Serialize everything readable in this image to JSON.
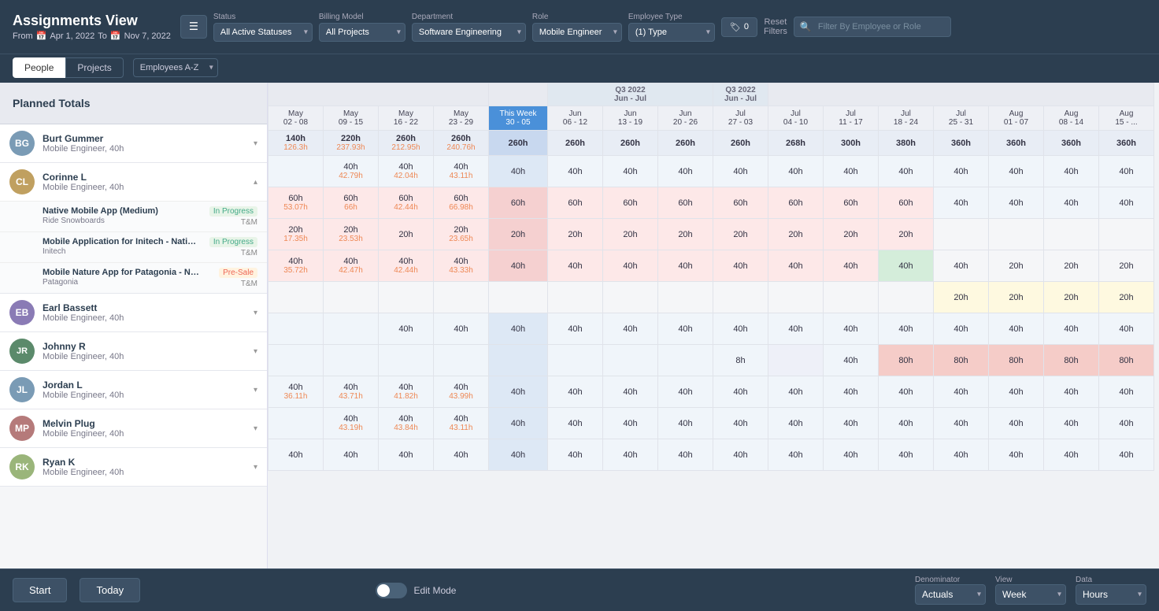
{
  "header": {
    "title": "Assignments View",
    "date_from_label": "From",
    "date_to_label": "To",
    "date_from": "Apr 1, 2022",
    "date_to": "Nov 7, 2022"
  },
  "filters": {
    "filter_icon_label": "☰",
    "status_label": "Status",
    "status_value": "All Active Statuses",
    "billing_label": "Billing Model",
    "billing_value": "All Projects",
    "dept_label": "Department",
    "dept_value": "Software Engineering",
    "role_label": "Role",
    "role_value": "Mobile Engineer",
    "emp_type_label": "Employee Type",
    "emp_type_value": "(1) Type",
    "tag_label": "0",
    "reset_label": "Reset\nFilters",
    "search_placeholder": "Filter By Employee or Role"
  },
  "toolbar": {
    "tab_people": "People",
    "tab_projects": "Projects",
    "sort_label": "Employees A-Z"
  },
  "planned_totals": "Planned Totals",
  "columns": [
    {
      "id": "may0208",
      "quarter": "",
      "label": "May\n02 - 08"
    },
    {
      "id": "may0915",
      "quarter": "",
      "label": "May\n09 - 15"
    },
    {
      "id": "may1622",
      "quarter": "",
      "label": "May\n16 - 22"
    },
    {
      "id": "may2329",
      "quarter": "",
      "label": "May\n23 - 29"
    },
    {
      "id": "thisweek",
      "quarter": "",
      "label": "This Week\n30 - 05",
      "current": true
    },
    {
      "id": "jun0612",
      "quarter": "Q3 2022\nJun - Jul",
      "label": "Jun\n06 - 12"
    },
    {
      "id": "jun1319",
      "quarter": "",
      "label": "Jun\n13 - 19"
    },
    {
      "id": "jun2026",
      "quarter": "",
      "label": "Jun\n20 - 26"
    },
    {
      "id": "jul2703",
      "quarter": "Q3 2022\nJun - Jul",
      "label": "Jul\n27 - 03"
    },
    {
      "id": "jul0410",
      "quarter": "",
      "label": "Jul\n04 - 10"
    },
    {
      "id": "jul1117",
      "quarter": "",
      "label": "Jul\n11 - 17"
    },
    {
      "id": "jul1824",
      "quarter": "",
      "label": "Jul\n18 - 24"
    },
    {
      "id": "jul2531",
      "quarter": "",
      "label": "Jul\n25 - 31"
    },
    {
      "id": "aug0107",
      "quarter": "",
      "label": "Aug\n01 - 07"
    },
    {
      "id": "aug0814",
      "quarter": "",
      "label": "Aug\n08 - 14"
    },
    {
      "id": "aug15",
      "quarter": "",
      "label": "Aug\n15 - ..."
    }
  ],
  "totals_row": {
    "values": {
      "may0208": {
        "main": "140h",
        "sub": "126.3h"
      },
      "may0915": {
        "main": "220h",
        "sub": "237.93h"
      },
      "may1622": {
        "main": "260h",
        "sub": "212.95h"
      },
      "may2329": {
        "main": "260h",
        "sub": "240.76h"
      },
      "thisweek": {
        "main": "260h",
        "sub": ""
      },
      "jun0612": {
        "main": "260h",
        "sub": ""
      },
      "jun1319": {
        "main": "260h",
        "sub": ""
      },
      "jun2026": {
        "main": "260h",
        "sub": ""
      },
      "jul2703": {
        "main": "260h",
        "sub": ""
      },
      "jul0410": {
        "main": "268h",
        "sub": ""
      },
      "jul1117": {
        "main": "300h",
        "sub": ""
      },
      "jul1824": {
        "main": "380h",
        "sub": ""
      },
      "jul2531": {
        "main": "360h",
        "sub": ""
      },
      "aug0107": {
        "main": "360h",
        "sub": ""
      },
      "aug0814": {
        "main": "360h",
        "sub": ""
      },
      "aug15": {
        "main": "360h",
        "sub": ""
      }
    }
  },
  "employees": [
    {
      "id": "burt",
      "name": "Burt Gummer",
      "role": "Mobile Engineer, 40h",
      "avatar_initials": "BG",
      "avatar_color": "#7a9bb5",
      "expanded": false,
      "values": {
        "may0208": {
          "main": "",
          "sub": ""
        },
        "may0915": {
          "main": "40h",
          "sub": "42.79h"
        },
        "may1622": {
          "main": "40h",
          "sub": "42.04h"
        },
        "may2329": {
          "main": "40h",
          "sub": "43.11h"
        },
        "thisweek": {
          "main": "40h",
          "sub": ""
        },
        "jun0612": {
          "main": "40h",
          "sub": ""
        },
        "jun1319": {
          "main": "40h",
          "sub": ""
        },
        "jun2026": {
          "main": "40h",
          "sub": ""
        },
        "jul2703": {
          "main": "40h",
          "sub": ""
        },
        "jul0410": {
          "main": "40h",
          "sub": ""
        },
        "jul1117": {
          "main": "40h",
          "sub": ""
        },
        "jul1824": {
          "main": "40h",
          "sub": ""
        },
        "jul2531": {
          "main": "40h",
          "sub": ""
        },
        "aug0107": {
          "main": "40h",
          "sub": ""
        },
        "aug0814": {
          "main": "40h",
          "sub": ""
        },
        "aug15": {
          "main": "40h",
          "sub": ""
        }
      }
    },
    {
      "id": "corinne",
      "name": "Corinne L",
      "role": "Mobile Engineer, 40h",
      "avatar_initials": "CL",
      "avatar_color": "#c0a060",
      "expanded": true,
      "values": {
        "may0208": {
          "main": "60h",
          "sub": "53.07h"
        },
        "may0915": {
          "main": "60h",
          "sub": "66h"
        },
        "may1622": {
          "main": "60h",
          "sub": "42.44h"
        },
        "may2329": {
          "main": "60h",
          "sub": "66.98h"
        },
        "thisweek": {
          "main": "60h",
          "sub": ""
        },
        "jun0612": {
          "main": "60h",
          "sub": ""
        },
        "jun1319": {
          "main": "60h",
          "sub": ""
        },
        "jun2026": {
          "main": "60h",
          "sub": ""
        },
        "jul2703": {
          "main": "60h",
          "sub": ""
        },
        "jul0410": {
          "main": "60h",
          "sub": ""
        },
        "jul1117": {
          "main": "60h",
          "sub": ""
        },
        "jul1824": {
          "main": "60h",
          "sub": ""
        },
        "jul2531": {
          "main": "40h",
          "sub": ""
        },
        "aug0107": {
          "main": "40h",
          "sub": ""
        },
        "aug0814": {
          "main": "40h",
          "sub": ""
        },
        "aug15": {
          "main": "40h",
          "sub": ""
        }
      },
      "projects": [
        {
          "id": "native-mobile",
          "name": "Native Mobile App (Medium)",
          "client": "Ride Snowboards",
          "status": "In Progress",
          "billing": "T&M",
          "color": "red",
          "values": {
            "may0208": {
              "main": "20h",
              "sub": "17.35h"
            },
            "may0915": {
              "main": "20h",
              "sub": "23.53h"
            },
            "may1622": {
              "main": "20h",
              "sub": ""
            },
            "may2329": {
              "main": "20h",
              "sub": "23.65h"
            },
            "thisweek": {
              "main": "20h",
              "sub": ""
            },
            "jun0612": {
              "main": "20h",
              "sub": ""
            },
            "jun1319": {
              "main": "20h",
              "sub": ""
            },
            "jun2026": {
              "main": "20h",
              "sub": ""
            },
            "jul2703": {
              "main": "20h",
              "sub": ""
            },
            "jul0410": {
              "main": "20h",
              "sub": ""
            },
            "jul1117": {
              "main": "20h",
              "sub": ""
            },
            "jul1824": {
              "main": "20h",
              "sub": ""
            },
            "jul2531": {
              "main": "",
              "sub": ""
            },
            "aug0107": {
              "main": "",
              "sub": ""
            },
            "aug0814": {
              "main": "",
              "sub": ""
            },
            "aug15": {
              "main": "",
              "sub": ""
            }
          }
        },
        {
          "id": "mobile-initech",
          "name": "Mobile Application for Initech - Native M...",
          "client": "Initech",
          "status": "In Progress",
          "billing": "T&M",
          "color": "red",
          "values": {
            "may0208": {
              "main": "40h",
              "sub": "35.72h"
            },
            "may0915": {
              "main": "40h",
              "sub": "42.47h"
            },
            "may1622": {
              "main": "40h",
              "sub": "42.44h"
            },
            "may2329": {
              "main": "40h",
              "sub": "43.33h"
            },
            "thisweek": {
              "main": "40h",
              "sub": ""
            },
            "jun0612": {
              "main": "40h",
              "sub": ""
            },
            "jun1319": {
              "main": "40h",
              "sub": ""
            },
            "jun2026": {
              "main": "40h",
              "sub": ""
            },
            "jul2703": {
              "main": "40h",
              "sub": ""
            },
            "jul0410": {
              "main": "40h",
              "sub": ""
            },
            "jul1117": {
              "main": "40h",
              "sub": ""
            },
            "jul1824": {
              "main": "40h",
              "sub": ""
            },
            "jul2531": {
              "main": "40h",
              "sub": ""
            },
            "aug0107": {
              "main": "20h",
              "sub": ""
            },
            "aug0814": {
              "main": "20h",
              "sub": ""
            },
            "aug15": {
              "main": "20h",
              "sub": ""
            }
          }
        },
        {
          "id": "mobile-patagonia",
          "name": "Mobile Nature App for Patagonia - Native...",
          "client": "Patagonia",
          "status": "Pre-Sale",
          "billing": "T&M",
          "color": "yellow",
          "values": {
            "may0208": {
              "main": "",
              "sub": ""
            },
            "may0915": {
              "main": "",
              "sub": ""
            },
            "may1622": {
              "main": "",
              "sub": ""
            },
            "may2329": {
              "main": "",
              "sub": ""
            },
            "thisweek": {
              "main": "",
              "sub": ""
            },
            "jun0612": {
              "main": "",
              "sub": ""
            },
            "jun1319": {
              "main": "",
              "sub": ""
            },
            "jun2026": {
              "main": "",
              "sub": ""
            },
            "jul2703": {
              "main": "",
              "sub": ""
            },
            "jul0410": {
              "main": "",
              "sub": ""
            },
            "jul1117": {
              "main": "",
              "sub": ""
            },
            "jul1824": {
              "main": "",
              "sub": ""
            },
            "jul2531": {
              "main": "20h",
              "sub": ""
            },
            "aug0107": {
              "main": "20h",
              "sub": ""
            },
            "aug0814": {
              "main": "20h",
              "sub": ""
            },
            "aug15": {
              "main": "20h",
              "sub": ""
            }
          }
        }
      ]
    },
    {
      "id": "earl",
      "name": "Earl Bassett",
      "role": "Mobile Engineer, 40h",
      "avatar_initials": "EB",
      "avatar_color": "#8a7bb5",
      "expanded": false,
      "values": {
        "may0208": {
          "main": "",
          "sub": ""
        },
        "may0915": {
          "main": "",
          "sub": ""
        },
        "may1622": {
          "main": "40h",
          "sub": ""
        },
        "may2329": {
          "main": "40h",
          "sub": ""
        },
        "thisweek": {
          "main": "40h",
          "sub": ""
        },
        "jun0612": {
          "main": "40h",
          "sub": ""
        },
        "jun1319": {
          "main": "40h",
          "sub": ""
        },
        "jun2026": {
          "main": "40h",
          "sub": ""
        },
        "jul2703": {
          "main": "40h",
          "sub": ""
        },
        "jul0410": {
          "main": "40h",
          "sub": ""
        },
        "jul1117": {
          "main": "40h",
          "sub": ""
        },
        "jul1824": {
          "main": "40h",
          "sub": ""
        },
        "jul2531": {
          "main": "40h",
          "sub": ""
        },
        "aug0107": {
          "main": "40h",
          "sub": ""
        },
        "aug0814": {
          "main": "40h",
          "sub": ""
        },
        "aug15": {
          "main": "40h",
          "sub": ""
        }
      }
    },
    {
      "id": "johnny",
      "name": "Johnny R",
      "role": "Mobile Engineer, 40h",
      "avatar_initials": "JR",
      "avatar_color": "#5b8a6b",
      "expanded": false,
      "values": {
        "may0208": {
          "main": "",
          "sub": ""
        },
        "may0915": {
          "main": "",
          "sub": ""
        },
        "may1622": {
          "main": "",
          "sub": ""
        },
        "may2329": {
          "main": "",
          "sub": ""
        },
        "thisweek": {
          "main": "",
          "sub": ""
        },
        "jun0612": {
          "main": "",
          "sub": ""
        },
        "jun1319": {
          "main": "",
          "sub": ""
        },
        "jun2026": {
          "main": "",
          "sub": ""
        },
        "jul2703": {
          "main": "8h",
          "sub": ""
        },
        "jul0410": {
          "main": "",
          "sub": ""
        },
        "jul1117": {
          "main": "40h",
          "sub": ""
        },
        "jul1824": {
          "main": "80h",
          "sub": ""
        },
        "jul2531": {
          "main": "80h",
          "sub": ""
        },
        "aug0107": {
          "main": "80h",
          "sub": ""
        },
        "aug0814": {
          "main": "80h",
          "sub": ""
        },
        "aug15": {
          "main": "80h",
          "sub": ""
        }
      }
    },
    {
      "id": "jordan",
      "name": "Jordan L",
      "role": "Mobile Engineer, 40h",
      "avatar_initials": "JL",
      "avatar_color": "#7a9bb5",
      "expanded": false,
      "values": {
        "may0208": {
          "main": "40h",
          "sub": "36.11h"
        },
        "may0915": {
          "main": "40h",
          "sub": "43.71h"
        },
        "may1622": {
          "main": "40h",
          "sub": "41.82h"
        },
        "may2329": {
          "main": "40h",
          "sub": "43.99h"
        },
        "thisweek": {
          "main": "40h",
          "sub": ""
        },
        "jun0612": {
          "main": "40h",
          "sub": ""
        },
        "jun1319": {
          "main": "40h",
          "sub": ""
        },
        "jun2026": {
          "main": "40h",
          "sub": ""
        },
        "jul2703": {
          "main": "40h",
          "sub": ""
        },
        "jul0410": {
          "main": "40h",
          "sub": ""
        },
        "jul1117": {
          "main": "40h",
          "sub": ""
        },
        "jul1824": {
          "main": "40h",
          "sub": ""
        },
        "jul2531": {
          "main": "40h",
          "sub": ""
        },
        "aug0107": {
          "main": "40h",
          "sub": ""
        },
        "aug0814": {
          "main": "40h",
          "sub": ""
        },
        "aug15": {
          "main": "40h",
          "sub": ""
        }
      }
    },
    {
      "id": "melvin",
      "name": "Melvin Plug",
      "role": "Mobile Engineer, 40h",
      "avatar_initials": "MP",
      "avatar_color": "#b57a7a",
      "expanded": false,
      "values": {
        "may0208": {
          "main": "",
          "sub": ""
        },
        "may0915": {
          "main": "40h",
          "sub": "43.19h"
        },
        "may1622": {
          "main": "40h",
          "sub": "43.84h"
        },
        "may2329": {
          "main": "40h",
          "sub": "43.11h"
        },
        "thisweek": {
          "main": "40h",
          "sub": ""
        },
        "jun0612": {
          "main": "40h",
          "sub": ""
        },
        "jun1319": {
          "main": "40h",
          "sub": ""
        },
        "jun2026": {
          "main": "40h",
          "sub": ""
        },
        "jul2703": {
          "main": "40h",
          "sub": ""
        },
        "jul0410": {
          "main": "40h",
          "sub": ""
        },
        "jul1117": {
          "main": "40h",
          "sub": ""
        },
        "jul1824": {
          "main": "40h",
          "sub": ""
        },
        "jul2531": {
          "main": "40h",
          "sub": ""
        },
        "aug0107": {
          "main": "40h",
          "sub": ""
        },
        "aug0814": {
          "main": "40h",
          "sub": ""
        },
        "aug15": {
          "main": "40h",
          "sub": ""
        }
      }
    },
    {
      "id": "ryan",
      "name": "Ryan K",
      "role": "Mobile Engineer, 40h",
      "avatar_initials": "RK",
      "avatar_color": "#9ab57a",
      "expanded": false,
      "values": {
        "may0208": {
          "main": "40h",
          "sub": ""
        },
        "may0915": {
          "main": "40h",
          "sub": ""
        },
        "may1622": {
          "main": "40h",
          "sub": ""
        },
        "may2329": {
          "main": "40h",
          "sub": ""
        },
        "thisweek": {
          "main": "40h",
          "sub": ""
        },
        "jun0612": {
          "main": "40h",
          "sub": ""
        },
        "jun1319": {
          "main": "40h",
          "sub": ""
        },
        "jun2026": {
          "main": "40h",
          "sub": ""
        },
        "jul2703": {
          "main": "40h",
          "sub": ""
        },
        "jul0410": {
          "main": "40h",
          "sub": ""
        },
        "jul1117": {
          "main": "40h",
          "sub": ""
        },
        "jul1824": {
          "main": "40h",
          "sub": ""
        },
        "jul2531": {
          "main": "40h",
          "sub": ""
        },
        "aug0107": {
          "main": "40h",
          "sub": ""
        },
        "aug0814": {
          "main": "40h",
          "sub": ""
        },
        "aug15": {
          "main": "40h",
          "sub": ""
        }
      }
    }
  ],
  "footer": {
    "start_label": "Start",
    "today_label": "Today",
    "edit_mode_label": "Edit Mode",
    "denominator_label": "Denominator",
    "denominator_value": "Actuals",
    "view_label": "View",
    "view_value": "Week",
    "data_label": "Data",
    "data_value": "Hours"
  }
}
